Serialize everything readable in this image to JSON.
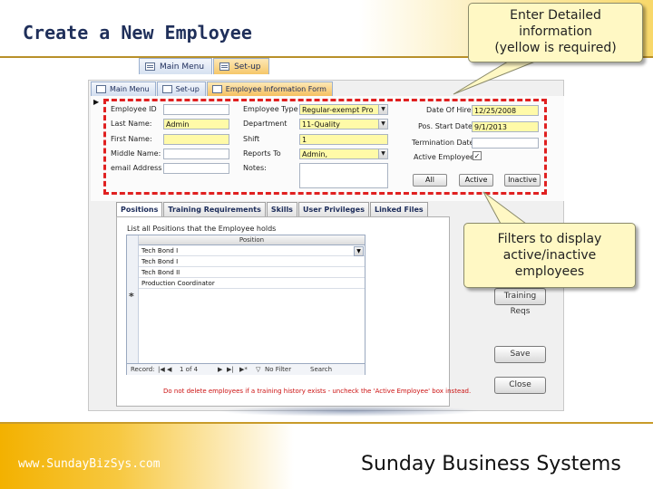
{
  "header": {
    "title": "Create a New Employee"
  },
  "callouts": {
    "top": [
      "Enter Detailed",
      "information",
      "(yellow is required)"
    ],
    "mid": [
      "Filters to display",
      "active/inactive",
      "employees"
    ]
  },
  "outer_tabs": [
    "Main Menu",
    "Set-up"
  ],
  "inner_tabs": [
    "Main Menu",
    "Set-up",
    "Employee Information Form"
  ],
  "form": {
    "labels": {
      "employee_id": "Employee ID",
      "last_name": "Last Name:",
      "first_name": "First Name:",
      "middle_name": "Middle Name:",
      "email": "email Address",
      "employee_type": "Employee Type",
      "department": "Department",
      "shift": "Shift",
      "reports_to": "Reports To",
      "notes": "Notes:",
      "date_of_hire": "Date Of Hire:",
      "pos_start_date": "Pos. Start Date:",
      "termination_date": "Termination Date:",
      "active_employee": "Active Employee"
    },
    "values": {
      "employee_id": "",
      "last_name": "Admin",
      "first_name": "",
      "middle_name": "",
      "email": "",
      "employee_type": "Regular-exempt Pro",
      "department": "11-Quality",
      "shift": "1",
      "reports_to": "Admin,",
      "notes": "",
      "date_of_hire": "12/25/2008",
      "pos_start_date": "9/1/2013",
      "termination_date": "",
      "active_employee_checked": true
    },
    "filter_buttons": [
      "All",
      "Active",
      "Inactive"
    ]
  },
  "sub_tabs": [
    "Positions",
    "Training Requirements",
    "Skills",
    "User Privileges",
    "Linked Files"
  ],
  "subform": {
    "caption": "List all Positions that the Employee holds",
    "column": "Position",
    "rows": [
      "Tech   Bond I",
      "Tech   Bond I",
      "Tech   Bond II",
      "Production Coordinator"
    ],
    "new_row_marker": "*",
    "nav": {
      "records_label": "Record:",
      "position": "1 of 4",
      "filter_label": "No Filter",
      "search_label": "Search"
    },
    "warning": "Do not delete employees if a training history exists - uncheck the 'Active Employee' box instead."
  },
  "side_buttons": [
    "Training Reqs",
    "Save",
    "Close"
  ],
  "footer": {
    "url": "www.SundayBizSys.com",
    "brand": "Sunday Business Systems"
  },
  "colors": {
    "required_field": "#fffaa8",
    "highlight_box": "#e02020",
    "callout_bg": "#fff8c4",
    "footer_gold": "#f3b100"
  }
}
